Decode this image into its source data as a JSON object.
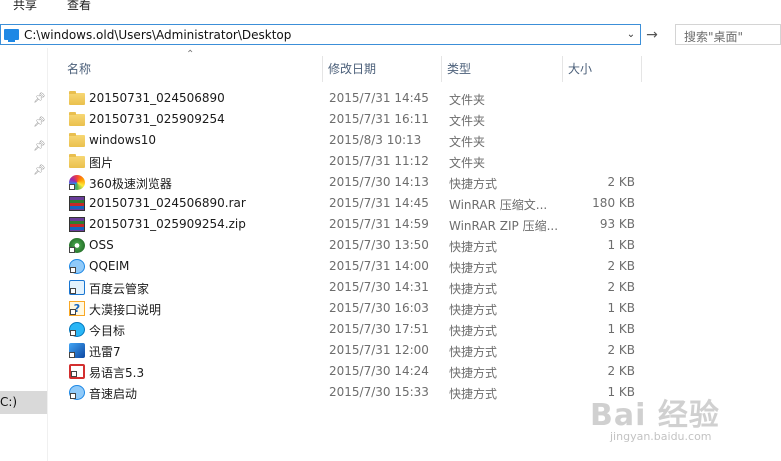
{
  "ribbon": {
    "tabs": [
      "共享",
      "查看"
    ]
  },
  "address": {
    "path": "C:\\windows.old\\Users\\Administrator\\Desktop"
  },
  "search": {
    "placeholder": "搜索\"桌面\""
  },
  "nav": {
    "selected_label": "C:)"
  },
  "columns": {
    "name": "名称",
    "date": "修改日期",
    "type": "类型",
    "size": "大小"
  },
  "files": [
    {
      "icon": "folder-icon",
      "name": "20150731_024506890",
      "date": "2015/7/31 14:45",
      "type": "文件夹",
      "size": ""
    },
    {
      "icon": "folder-icon",
      "name": "20150731_025909254",
      "date": "2015/7/31 16:11",
      "type": "文件夹",
      "size": ""
    },
    {
      "icon": "folder-icon",
      "name": "windows10",
      "date": "2015/8/3 10:13",
      "type": "文件夹",
      "size": ""
    },
    {
      "icon": "folder-icon",
      "name": "图片",
      "date": "2015/7/31 11:12",
      "type": "文件夹",
      "size": ""
    },
    {
      "icon": "browser-shortcut-icon",
      "name": "360极速浏览器",
      "date": "2015/7/30 14:13",
      "type": "快捷方式",
      "size": "2 KB"
    },
    {
      "icon": "winrar-archive-icon",
      "name": "20150731_024506890.rar",
      "date": "2015/7/31 14:45",
      "type": "WinRAR 压缩文...",
      "size": "180 KB"
    },
    {
      "icon": "winrar-archive-icon",
      "name": "20150731_025909254.zip",
      "date": "2015/7/31 14:59",
      "type": "WinRAR ZIP 压缩...",
      "size": "93 KB"
    },
    {
      "icon": "oss-shortcut-icon",
      "name": "OSS",
      "date": "2015/7/30 13:50",
      "type": "快捷方式",
      "size": "1 KB"
    },
    {
      "icon": "qq-shortcut-icon",
      "name": "QQEIM",
      "date": "2015/7/31 14:00",
      "type": "快捷方式",
      "size": "2 KB"
    },
    {
      "icon": "baidu-cloud-shortcut-icon",
      "name": "百度云管家",
      "date": "2015/7/30 14:31",
      "type": "快捷方式",
      "size": "2 KB"
    },
    {
      "icon": "help-shortcut-icon",
      "name": "大漠接口说明",
      "date": "2015/7/30 16:03",
      "type": "快捷方式",
      "size": "1 KB"
    },
    {
      "icon": "target-shortcut-icon",
      "name": "今目标",
      "date": "2015/7/30 17:51",
      "type": "快捷方式",
      "size": "1 KB"
    },
    {
      "icon": "xunlei-shortcut-icon",
      "name": "迅雷7",
      "date": "2015/7/31 12:00",
      "type": "快捷方式",
      "size": "2 KB"
    },
    {
      "icon": "eyuyan-shortcut-icon",
      "name": "易语言5.3",
      "date": "2015/7/30 14:24",
      "type": "快捷方式",
      "size": "2 KB"
    },
    {
      "icon": "speed-start-shortcut-icon",
      "name": "音速启动",
      "date": "2015/7/30 15:33",
      "type": "快捷方式",
      "size": "1 KB"
    }
  ],
  "watermark": {
    "logo": "Bai 经验",
    "site": "jingyan.baidu.com"
  }
}
